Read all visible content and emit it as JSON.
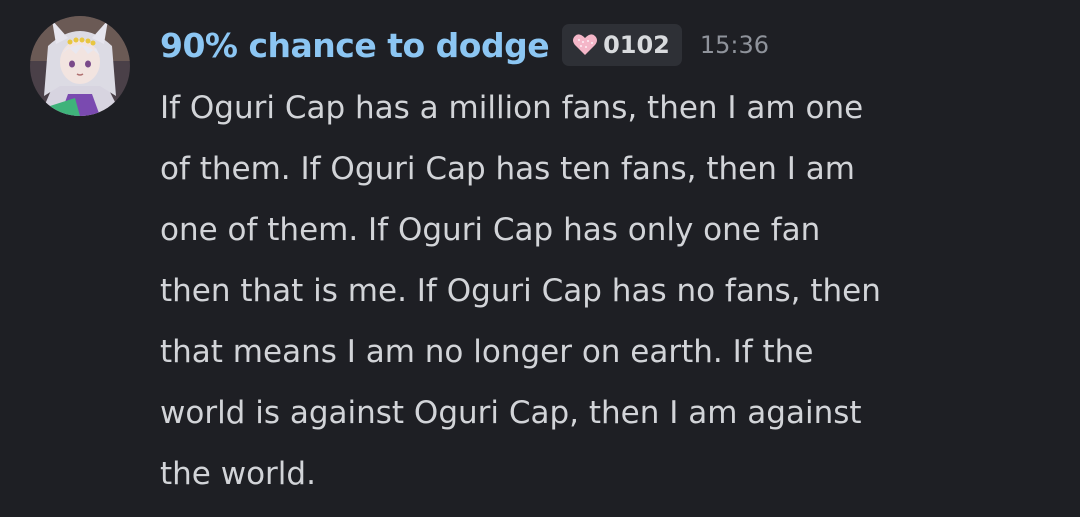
{
  "message": {
    "author": {
      "display_name": "90% chance to dodge",
      "avatar_icon": "anime-girl-avatar",
      "name_color": "#8cc6f3"
    },
    "guild_tag": {
      "icon": "pink-heart-icon",
      "text": "0102"
    },
    "timestamp": "15:36",
    "content_lines": [
      "If Oguri Cap has a million fans, then I am one",
      "of them. If Oguri Cap has ten fans, then I am",
      "one of them. If Oguri Cap has only one fan",
      "then that is me. If Oguri Cap has no fans, then",
      "that means I am no longer on earth. If the",
      "world is against Oguri Cap, then I am against",
      "the world."
    ]
  },
  "colors": {
    "background": "#1e1f24",
    "text": "#d2d4d8",
    "timestamp": "#8f939b",
    "tag_background": "#2e3036"
  }
}
